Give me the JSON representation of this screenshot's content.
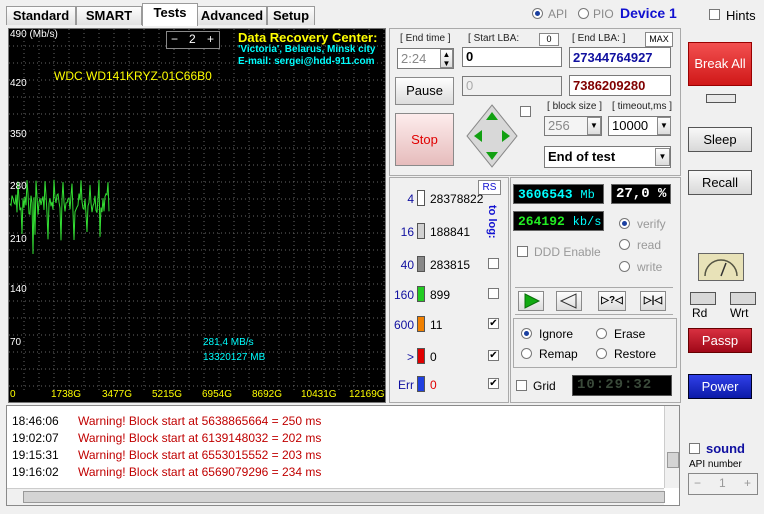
{
  "tabs": [
    {
      "label": "Standard"
    },
    {
      "label": "SMART"
    },
    {
      "label": "Tests"
    },
    {
      "label": "Advanced"
    },
    {
      "label": "Setup"
    }
  ],
  "top": {
    "api_label": "API",
    "pio_label": "PIO",
    "device_label": "Device 1",
    "hints_label": "Hints"
  },
  "graph": {
    "y_unit": "490 (Mb/s)",
    "y_ticks": [
      "420",
      "350",
      "280",
      "210",
      "140",
      "70"
    ],
    "x_ticks": [
      "0",
      "1738G",
      "3477G",
      "5215G",
      "6954G",
      "8692G",
      "10431G",
      "12169G"
    ],
    "drive_model": "WDC WD141KRYZ-01C66B0",
    "scale_value": "2",
    "minus": "−",
    "plus": "+",
    "center_title": "Data Recovery Center:",
    "center_line2": "'Victoria', Belarus, Minsk city",
    "center_line3": "E-mail: sergei@hdd-911.com",
    "speed_label": "281,4 MB/s",
    "mb_label": "13320127 MB"
  },
  "controls": {
    "end_time_label": "End time",
    "end_time_value": "2:24",
    "start_lba_label": "Start LBA:",
    "start_lba_zero": "0",
    "start_lba_value": "0",
    "start_lba_current": "0",
    "end_lba_label": "End LBA:",
    "max_label": "MAX",
    "end_lba_value": "27344764927",
    "end_lba_current": "7386209280",
    "pause_label": "Pause",
    "stop_label": "Stop",
    "block_size_label": "block size",
    "block_size_value": "256",
    "timeout_label": "timeout,ms",
    "timeout_value": "10000",
    "end_of_test_value": "End of test"
  },
  "stats": {
    "rs_label": "RS",
    "to_log_label": "to log:",
    "rows": [
      {
        "ms": "4",
        "count": "28378822",
        "color": "#ffffff",
        "checked": false
      },
      {
        "ms": "16",
        "count": "188841",
        "color": "#d0d0d0",
        "checked": false
      },
      {
        "ms": "40",
        "count": "283815",
        "color": "#888888",
        "checked": false
      },
      {
        "ms": "160",
        "count": "899",
        "color": "#22cc22",
        "checked": false
      },
      {
        "ms": "600",
        "count": "11",
        "color": "#f08000",
        "checked": true
      },
      {
        "ms": ">",
        "count": "0",
        "color": "#e00000",
        "checked": true
      },
      {
        "ms": "Err",
        "count": "0",
        "color": "#2040e0",
        "checked": true
      }
    ]
  },
  "progress": {
    "mb_value": "3606543",
    "mb_unit": "Mb",
    "percent": "27,0 %",
    "kbs_value": "264192",
    "kbs_unit": "kb/s",
    "verify_label": "verify",
    "read_label": "read",
    "write_label": "write",
    "ddd_label": "DDD Enable",
    "ignore_label": "Ignore",
    "erase_label": "Erase",
    "remap_label": "Remap",
    "restore_label": "Restore",
    "grid_label": "Grid",
    "clock": "10:29:32"
  },
  "side": {
    "break_all_label": "Break All",
    "sleep_label": "Sleep",
    "recall_label": "Recall",
    "rd_label": "Rd",
    "wrt_label": "Wrt",
    "passp_label": "Passp",
    "power_label": "Power",
    "sound_label": "sound",
    "api_number_label": "API number",
    "api_number_value": "1",
    "minus": "−",
    "plus": "+"
  },
  "log": [
    {
      "time": "18:46:06",
      "message": "Warning! Block start at 5638865664 = 250 ms"
    },
    {
      "time": "19:02:07",
      "message": "Warning! Block start at 6139148032 = 202 ms"
    },
    {
      "time": "19:15:31",
      "message": "Warning! Block start at 6553015552 = 203 ms"
    },
    {
      "time": "19:16:02",
      "message": "Warning! Block start at 6569079296 = 234 ms"
    }
  ],
  "colors": {
    "graph_line": "#33dd33",
    "label_yellow": "#ffff00",
    "label_cyan": "#00ffff",
    "warning_red": "#c00000",
    "break_all_red": "#e02020",
    "passp_red": "#c8102e",
    "power_blue": "#1a2fd0",
    "device_blue": "#1010d0"
  }
}
